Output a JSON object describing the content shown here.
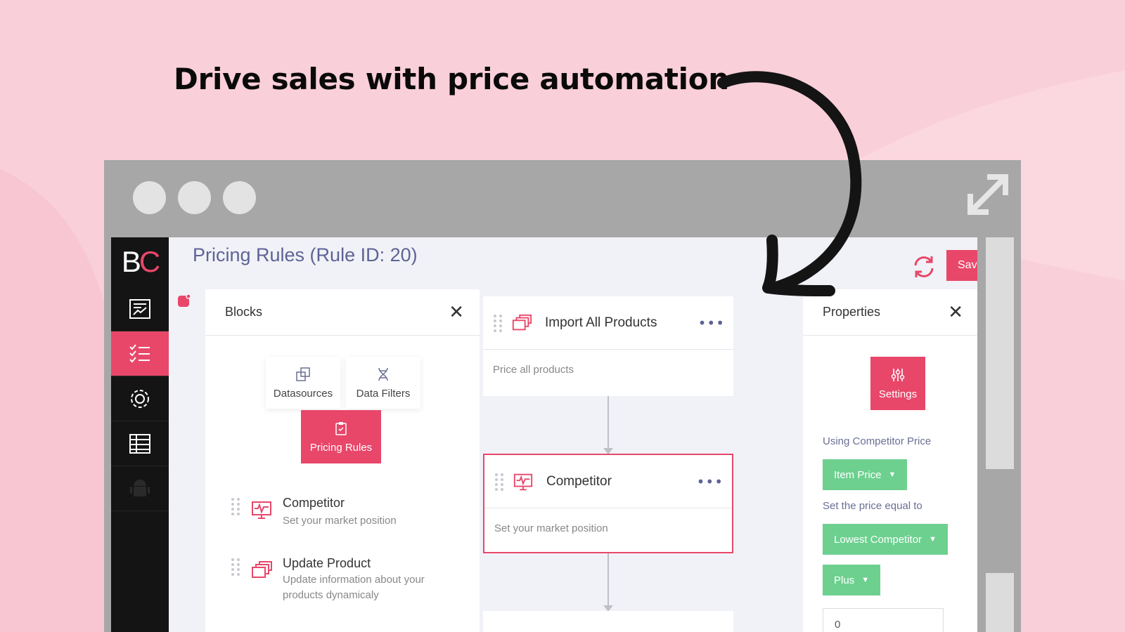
{
  "headline": "Drive sales with price automation",
  "app": {
    "logo": {
      "b": "B",
      "c": "C"
    },
    "page_title": "Pricing Rules (Rule ID: 20)",
    "save_label": "Save",
    "sidebar_icons": [
      "report-icon",
      "checklist-icon",
      "gear-icon",
      "table-icon",
      "android-icon"
    ]
  },
  "blocks": {
    "title": "Blocks",
    "categories": [
      {
        "label": "Datasources",
        "icon": "datasources-icon"
      },
      {
        "label": "Data Filters",
        "icon": "dna-icon"
      },
      {
        "label": "Pricing Rules",
        "icon": "clipboard-icon"
      }
    ],
    "items": [
      {
        "title": "Competitor",
        "desc": "Set your market position",
        "icon": "monitor-pulse-icon"
      },
      {
        "title": "Update Product",
        "desc_line1": "Update information about your",
        "desc_line2": "products dynamicaly",
        "icon": "stack-icon"
      }
    ]
  },
  "flow": {
    "nodes": [
      {
        "title": "Import All Products",
        "desc": "Price all products"
      },
      {
        "title": "Competitor",
        "desc": "Set your market position"
      }
    ]
  },
  "properties": {
    "title": "Properties",
    "settings_label": "Settings",
    "label_using": "Using Competitor Price",
    "item_price": "Item Price",
    "label_set_equal": "Set the price equal to",
    "lowest_competitor": "Lowest Competitor",
    "plus": "Plus",
    "value_input": "0"
  },
  "colors": {
    "accent": "#e8476a",
    "green": "#6dd08f",
    "title": "#5d6395"
  }
}
